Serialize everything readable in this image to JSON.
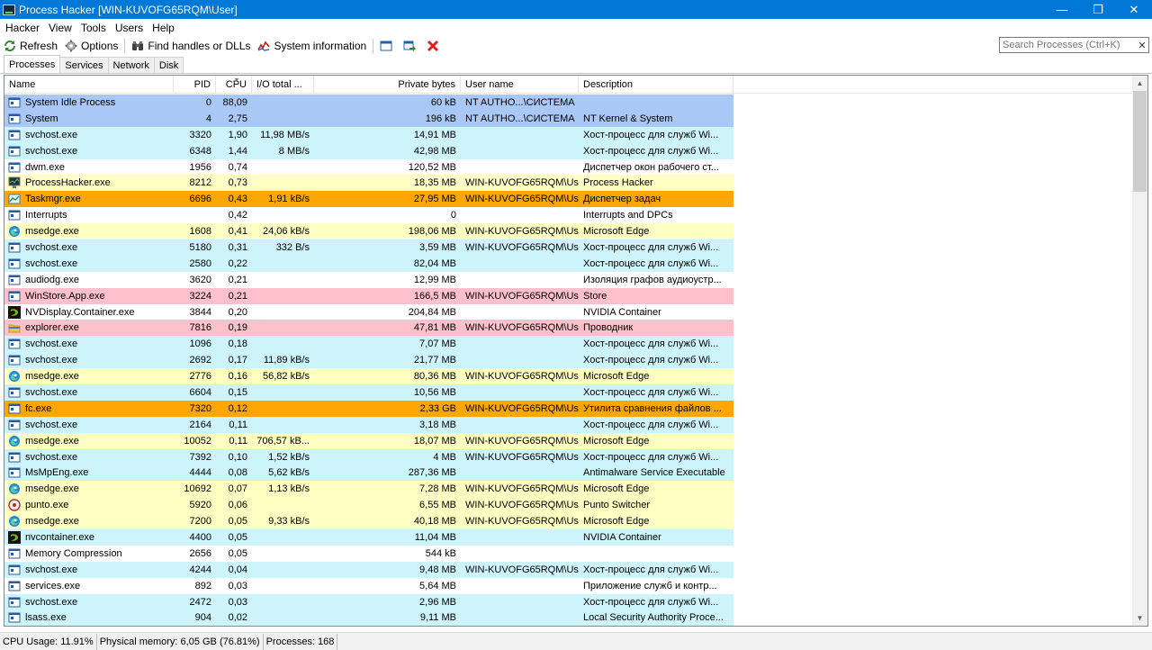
{
  "window": {
    "title": "Process Hacker [WIN-KUVOFG65RQM\\User]"
  },
  "menu": [
    "Hacker",
    "View",
    "Tools",
    "Users",
    "Help"
  ],
  "toolbar": {
    "refresh": "Refresh",
    "options": "Options",
    "find_handles": "Find handles or DLLs",
    "system_info": "System information",
    "search_placeholder": "Search Processes (Ctrl+K)"
  },
  "tabs": [
    "Processes",
    "Services",
    "Network",
    "Disk"
  ],
  "columns": [
    "Name",
    "PID",
    "CPU",
    "I/O total ...",
    "Private bytes",
    "User name",
    "Description"
  ],
  "colors": {
    "system": "#aac8f5",
    "service": "#cdf4fb",
    "own": "#ffffc4",
    "immersive": "#fec0cb",
    "jobs": "#fea600",
    "normal": "#ffffff"
  },
  "processes": [
    {
      "name": "System Idle Process",
      "pid": "0",
      "cpu": "88,09",
      "io": "",
      "priv": "60 kB",
      "user": "NT AUTHO...\\СИСТЕМА",
      "desc": "",
      "kind": "system",
      "icon": "window-icon"
    },
    {
      "name": "System",
      "pid": "4",
      "cpu": "2,75",
      "io": "",
      "priv": "196 kB",
      "user": "NT AUTHO...\\СИСТЕМА",
      "desc": "NT Kernel & System",
      "kind": "system",
      "icon": "window-icon"
    },
    {
      "name": "svchost.exe",
      "pid": "3320",
      "cpu": "1,90",
      "io": "11,98 MB/s",
      "priv": "14,91 MB",
      "user": "",
      "desc": "Хост-процесс для служб Wi...",
      "kind": "service",
      "icon": "window-icon"
    },
    {
      "name": "svchost.exe",
      "pid": "6348",
      "cpu": "1,44",
      "io": "8 MB/s",
      "priv": "42,98 MB",
      "user": "",
      "desc": "Хост-процесс для служб Wi...",
      "kind": "service",
      "icon": "window-icon"
    },
    {
      "name": "dwm.exe",
      "pid": "1956",
      "cpu": "0,74",
      "io": "",
      "priv": "120,52 MB",
      "user": "",
      "desc": "Диспетчер окон рабочего ст...",
      "kind": "normal",
      "icon": "window-icon"
    },
    {
      "name": "ProcessHacker.exe",
      "pid": "8212",
      "cpu": "0,73",
      "io": "",
      "priv": "18,35 MB",
      "user": "WIN-KUVOFG65RQM\\Us",
      "desc": "Process Hacker",
      "kind": "own",
      "icon": "monitor-icon"
    },
    {
      "name": "Taskmgr.exe",
      "pid": "6696",
      "cpu": "0,43",
      "io": "1,91 kB/s",
      "priv": "27,95 MB",
      "user": "WIN-KUVOFG65RQM\\Us",
      "desc": "Диспетчер задач",
      "kind": "jobs",
      "icon": "taskmgr-icon"
    },
    {
      "name": "Interrupts",
      "pid": "",
      "cpu": "0,42",
      "io": "",
      "priv": "0",
      "user": "",
      "desc": "Interrupts and DPCs",
      "kind": "normal",
      "icon": "window-icon"
    },
    {
      "name": "msedge.exe",
      "pid": "1608",
      "cpu": "0,41",
      "io": "24,06 kB/s",
      "priv": "198,06 MB",
      "user": "WIN-KUVOFG65RQM\\Us",
      "desc": "Microsoft Edge",
      "kind": "own",
      "icon": "edge-icon"
    },
    {
      "name": "svchost.exe",
      "pid": "5180",
      "cpu": "0,31",
      "io": "332 B/s",
      "priv": "3,59 MB",
      "user": "WIN-KUVOFG65RQM\\Us",
      "desc": "Хост-процесс для служб Wi...",
      "kind": "service",
      "icon": "window-icon"
    },
    {
      "name": "svchost.exe",
      "pid": "2580",
      "cpu": "0,22",
      "io": "",
      "priv": "82,04 MB",
      "user": "",
      "desc": "Хост-процесс для служб Wi...",
      "kind": "service",
      "icon": "window-icon"
    },
    {
      "name": "audiodg.exe",
      "pid": "3620",
      "cpu": "0,21",
      "io": "",
      "priv": "12,99 MB",
      "user": "",
      "desc": "Изоляция графов аудиоустр...",
      "kind": "normal",
      "icon": "window-icon"
    },
    {
      "name": "WinStore.App.exe",
      "pid": "3224",
      "cpu": "0,21",
      "io": "",
      "priv": "166,5 MB",
      "user": "WIN-KUVOFG65RQM\\Us",
      "desc": "Store",
      "kind": "immersive",
      "icon": "window-icon"
    },
    {
      "name": "NVDisplay.Container.exe",
      "pid": "3844",
      "cpu": "0,20",
      "io": "",
      "priv": "204,84 MB",
      "user": "",
      "desc": "NVIDIA Container",
      "kind": "normal",
      "icon": "nvidia-icon"
    },
    {
      "name": "explorer.exe",
      "pid": "7816",
      "cpu": "0,19",
      "io": "",
      "priv": "47,81 MB",
      "user": "WIN-KUVOFG65RQM\\Us",
      "desc": "Проводник",
      "kind": "immersive",
      "icon": "folder-icon"
    },
    {
      "name": "svchost.exe",
      "pid": "1096",
      "cpu": "0,18",
      "io": "",
      "priv": "7,07 MB",
      "user": "",
      "desc": "Хост-процесс для служб Wi...",
      "kind": "service",
      "icon": "window-icon"
    },
    {
      "name": "svchost.exe",
      "pid": "2692",
      "cpu": "0,17",
      "io": "11,89 kB/s",
      "priv": "21,77 MB",
      "user": "",
      "desc": "Хост-процесс для служб Wi...",
      "kind": "service",
      "icon": "window-icon"
    },
    {
      "name": "msedge.exe",
      "pid": "2776",
      "cpu": "0,16",
      "io": "56,82 kB/s",
      "priv": "80,36 MB",
      "user": "WIN-KUVOFG65RQM\\Us",
      "desc": "Microsoft Edge",
      "kind": "own",
      "icon": "edge-icon"
    },
    {
      "name": "svchost.exe",
      "pid": "6604",
      "cpu": "0,15",
      "io": "",
      "priv": "10,56 MB",
      "user": "",
      "desc": "Хост-процесс для служб Wi...",
      "kind": "service",
      "icon": "window-icon"
    },
    {
      "name": "fc.exe",
      "pid": "7320",
      "cpu": "0,12",
      "io": "",
      "priv": "2,33 GB",
      "user": "WIN-KUVOFG65RQM\\Us",
      "desc": "Утилита сравнения файлов ...",
      "kind": "jobs",
      "icon": "window-icon"
    },
    {
      "name": "svchost.exe",
      "pid": "2164",
      "cpu": "0,11",
      "io": "",
      "priv": "3,18 MB",
      "user": "",
      "desc": "Хост-процесс для служб Wi...",
      "kind": "service",
      "icon": "window-icon"
    },
    {
      "name": "msedge.exe",
      "pid": "10052",
      "cpu": "0,11",
      "io": "706,57 kB...",
      "priv": "18,07 MB",
      "user": "WIN-KUVOFG65RQM\\Us",
      "desc": "Microsoft Edge",
      "kind": "own",
      "icon": "edge-icon"
    },
    {
      "name": "svchost.exe",
      "pid": "7392",
      "cpu": "0,10",
      "io": "1,52 kB/s",
      "priv": "4 MB",
      "user": "WIN-KUVOFG65RQM\\Us",
      "desc": "Хост-процесс для служб Wi...",
      "kind": "service",
      "icon": "window-icon"
    },
    {
      "name": "MsMpEng.exe",
      "pid": "4444",
      "cpu": "0,08",
      "io": "5,62 kB/s",
      "priv": "287,36 MB",
      "user": "",
      "desc": "Antimalware Service Executable",
      "kind": "service",
      "icon": "window-icon"
    },
    {
      "name": "msedge.exe",
      "pid": "10692",
      "cpu": "0,07",
      "io": "1,13 kB/s",
      "priv": "7,28 MB",
      "user": "WIN-KUVOFG65RQM\\Us",
      "desc": "Microsoft Edge",
      "kind": "own",
      "icon": "edge-icon"
    },
    {
      "name": "punto.exe",
      "pid": "5920",
      "cpu": "0,06",
      "io": "",
      "priv": "6,55 MB",
      "user": "WIN-KUVOFG65RQM\\Us",
      "desc": "Punto Switcher",
      "kind": "own",
      "icon": "punto-icon"
    },
    {
      "name": "msedge.exe",
      "pid": "7200",
      "cpu": "0,05",
      "io": "9,33 kB/s",
      "priv": "40,18 MB",
      "user": "WIN-KUVOFG65RQM\\Us",
      "desc": "Microsoft Edge",
      "kind": "own",
      "icon": "edge-icon"
    },
    {
      "name": "nvcontainer.exe",
      "pid": "4400",
      "cpu": "0,05",
      "io": "",
      "priv": "11,04 MB",
      "user": "",
      "desc": "NVIDIA Container",
      "kind": "service",
      "icon": "nvidia-icon"
    },
    {
      "name": "Memory Compression",
      "pid": "2656",
      "cpu": "0,05",
      "io": "",
      "priv": "544 kB",
      "user": "",
      "desc": "",
      "kind": "normal",
      "icon": "window-icon"
    },
    {
      "name": "svchost.exe",
      "pid": "4244",
      "cpu": "0,04",
      "io": "",
      "priv": "9,48 MB",
      "user": "WIN-KUVOFG65RQM\\Us",
      "desc": "Хост-процесс для служб Wi...",
      "kind": "service",
      "icon": "window-icon"
    },
    {
      "name": "services.exe",
      "pid": "892",
      "cpu": "0,03",
      "io": "",
      "priv": "5,64 MB",
      "user": "",
      "desc": "Приложение служб и контр...",
      "kind": "normal",
      "icon": "window-icon"
    },
    {
      "name": "svchost.exe",
      "pid": "2472",
      "cpu": "0,03",
      "io": "",
      "priv": "2,96 MB",
      "user": "",
      "desc": "Хост-процесс для служб Wi...",
      "kind": "service",
      "icon": "window-icon"
    },
    {
      "name": "lsass.exe",
      "pid": "904",
      "cpu": "0,02",
      "io": "",
      "priv": "9,11 MB",
      "user": "",
      "desc": "Local Security Authority Proce...",
      "kind": "service",
      "icon": "window-icon"
    }
  ],
  "status": {
    "cpu": "CPU Usage: 11.91%",
    "memory": "Physical memory: 6,05 GB (76.81%)",
    "processes": "Processes: 168"
  }
}
